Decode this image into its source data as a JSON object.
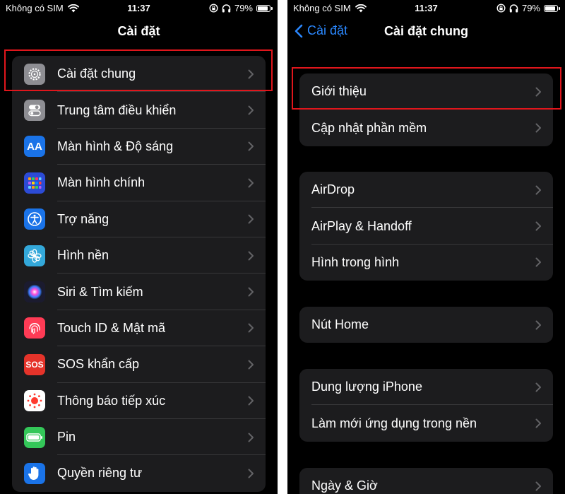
{
  "left": {
    "status": {
      "carrier": "Không có SIM",
      "time": "11:37",
      "battery": "79%",
      "battery_level": 0.79
    },
    "title": "Cài đặt",
    "items": [
      {
        "label": "Cài đặt chung",
        "icon": "gear-icon",
        "color": "#8e8e93"
      },
      {
        "label": "Trung tâm điều khiển",
        "icon": "toggles-icon",
        "color": "#8e8e93"
      },
      {
        "label": "Màn hình & Độ sáng",
        "icon": "aa-text-icon",
        "icon_text": "AA",
        "color": "#1a73e8"
      },
      {
        "label": "Màn hình chính",
        "icon": "app-grid-icon",
        "color": "#2c4bd6"
      },
      {
        "label": "Trợ năng",
        "icon": "accessibility-icon",
        "color": "#1a73e8"
      },
      {
        "label": "Hình nền",
        "icon": "flower-icon",
        "color": "#33a8da"
      },
      {
        "label": "Siri & Tìm kiếm",
        "icon": "siri-icon",
        "color": "#1b1b2f"
      },
      {
        "label": "Touch ID & Mật mã",
        "icon": "fingerprint-icon",
        "color": "#ff3b55"
      },
      {
        "label": "SOS khẩn cấp",
        "icon": "sos-icon",
        "icon_text": "SOS",
        "color": "#e5332a"
      },
      {
        "label": "Thông báo tiếp xúc",
        "icon": "exposure-icon",
        "color": "#ffffff"
      },
      {
        "label": "Pin",
        "icon": "battery-icon",
        "color": "#34c759"
      },
      {
        "label": "Quyền riêng tư",
        "icon": "hand-icon",
        "color": "#1a73e8"
      }
    ]
  },
  "right": {
    "status": {
      "carrier": "Không có SIM",
      "time": "11:37",
      "battery": "79%",
      "battery_level": 0.79
    },
    "back_label": "Cài đặt",
    "title": "Cài đặt chung",
    "groups": [
      {
        "items": [
          "Giới thiệu",
          "Cập nhật phần mềm"
        ]
      },
      {
        "items": [
          "AirDrop",
          "AirPlay & Handoff",
          "Hình trong hình"
        ]
      },
      {
        "items": [
          "Nút Home"
        ]
      },
      {
        "items": [
          "Dung lượng iPhone",
          "Làm mới ứng dụng trong nền"
        ]
      },
      {
        "items": [
          "Ngày & Giờ"
        ]
      }
    ]
  },
  "colors": {
    "accent": "#2b88ff",
    "highlight": "#e0161c",
    "cell": "#1c1c1e"
  }
}
